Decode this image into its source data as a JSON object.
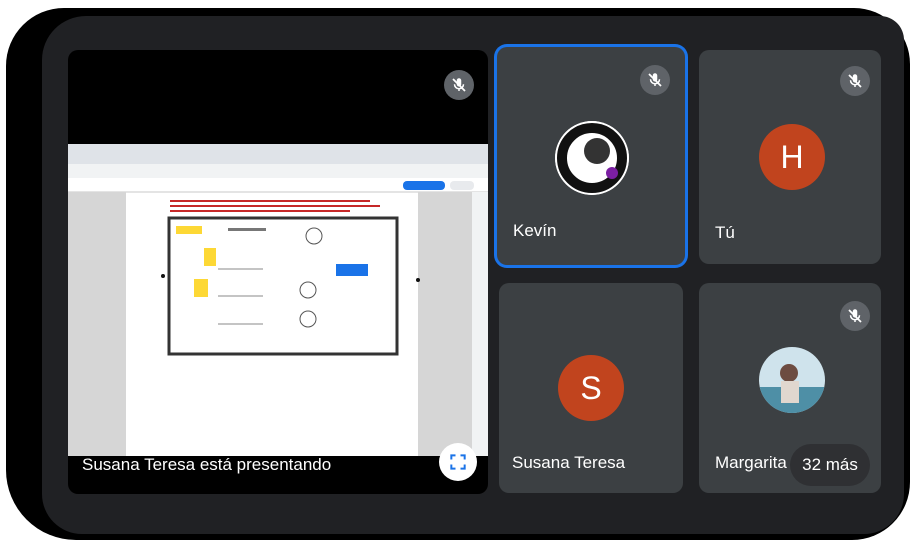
{
  "presentation": {
    "caption": "Susana Teresa está presentando"
  },
  "participants": [
    {
      "name": "Kevín",
      "muted": true,
      "avatar_type": "photo",
      "active_speaker": true
    },
    {
      "name": "Tú",
      "muted": true,
      "avatar_type": "letter",
      "initial": "H"
    },
    {
      "name": "Susana Teresa",
      "muted": false,
      "avatar_type": "letter",
      "initial": "S"
    },
    {
      "name": "Margarita",
      "muted": true,
      "avatar_type": "photo"
    }
  ],
  "more_participants": {
    "label": "32 más"
  },
  "colors": {
    "window_bg": "#202124",
    "tile_bg": "#3c4043",
    "active_border": "#1a73e8",
    "avatar_orange": "#c1441e",
    "mic_off_bg": "#5f6368"
  },
  "icons": {
    "mic_off": "mic-off-icon",
    "fullscreen": "fullscreen-icon"
  }
}
